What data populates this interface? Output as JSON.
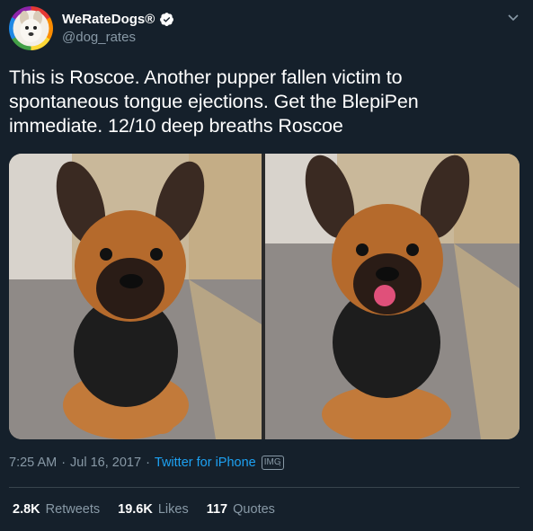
{
  "author": {
    "display_name": "WeRateDogs®",
    "handle": "@dog_rates",
    "verified": true
  },
  "tweet": {
    "text_lines": [
      "This is Roscoe. Another pupper fallen victim to",
      "spontaneous tongue ejections. Get the BlepiPen",
      "immediate. 12/10 deep breaths Roscoe"
    ]
  },
  "media": {
    "count": 2,
    "left_photo": "french-bulldog-puppy-sitting",
    "right_photo": "french-bulldog-puppy-tongue-out"
  },
  "meta": {
    "time": "7:25 AM",
    "separator": "·",
    "date": "Jul 16, 2017",
    "source": "Twitter for iPhone",
    "badge": "IMGฺ"
  },
  "stats": {
    "retweets_value": "2.8K",
    "retweets_label": "Retweets",
    "likes_value": "19.6K",
    "likes_label": "Likes",
    "quotes_value": "117",
    "quotes_label": "Quotes"
  },
  "colors": {
    "background": "#15202b",
    "secondary_text": "#8899a6",
    "link": "#1da1f2",
    "divider": "#38444d"
  }
}
